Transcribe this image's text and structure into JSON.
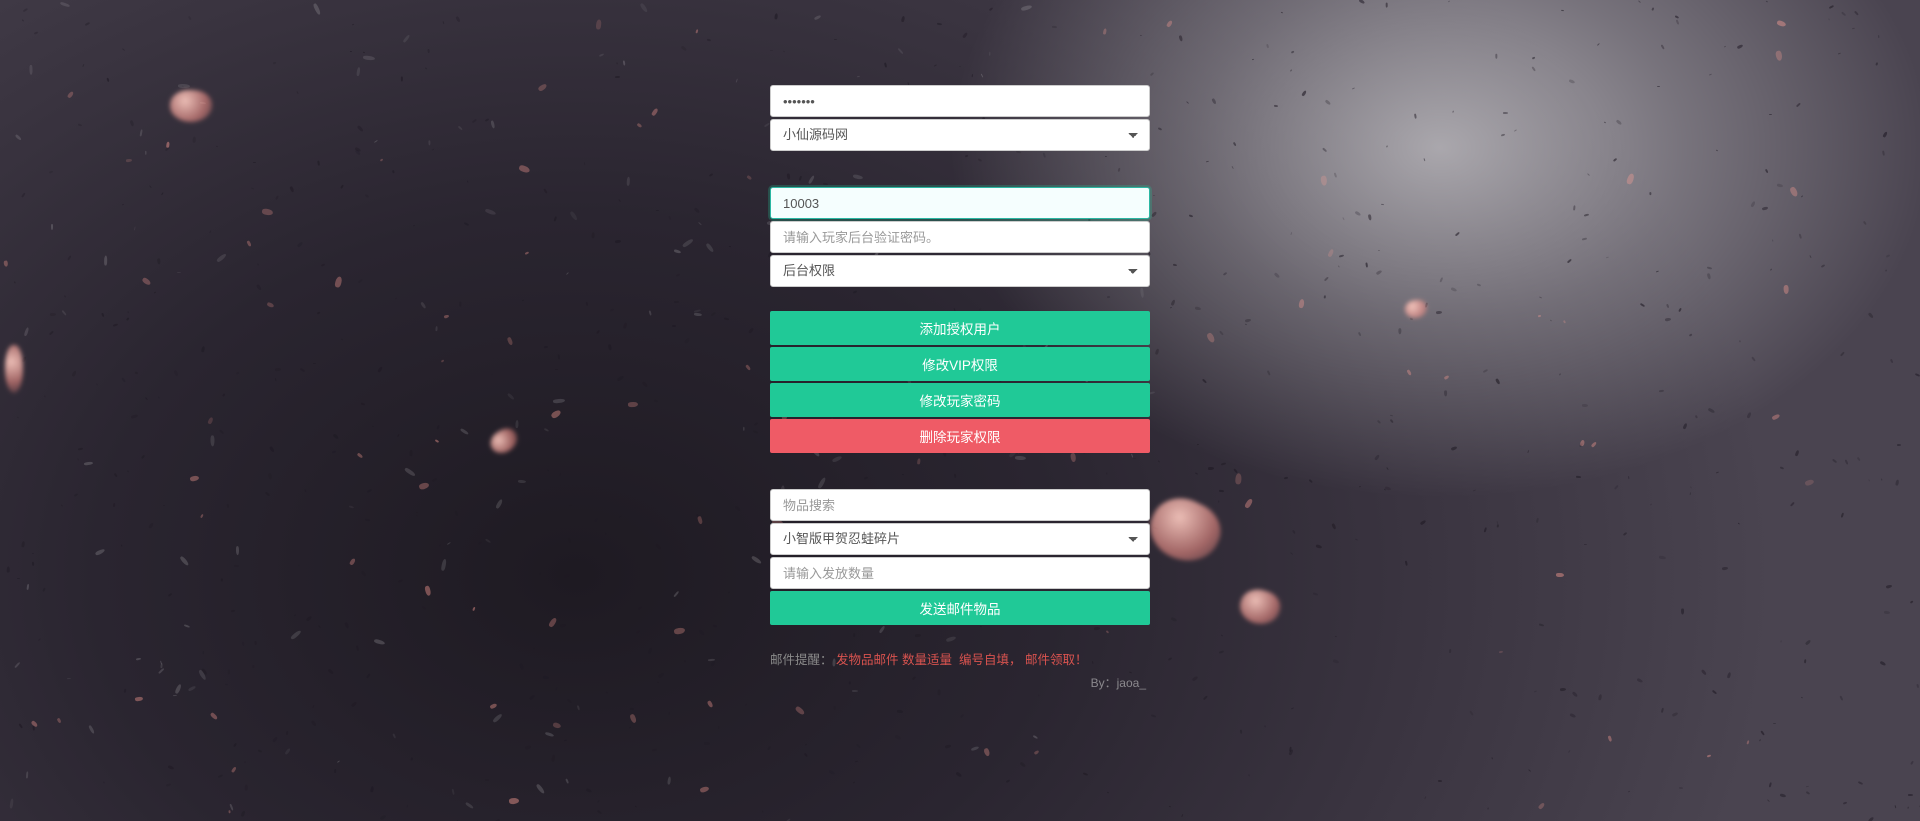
{
  "section1": {
    "password_value": "•••••••",
    "select_value": "小仙源码网"
  },
  "section2": {
    "player_id_value": "10003",
    "verify_pwd_placeholder": "请输入玩家后台验证密码。",
    "perm_select_value": "后台权限",
    "btn_add_user": "添加授权用户",
    "btn_mod_vip": "修改VIP权限",
    "btn_mod_pwd": "修改玩家密码",
    "btn_del_perm": "删除玩家权限"
  },
  "section3": {
    "search_placeholder": "物品搜索",
    "item_select_value": "小智版甲贺忍蛙碎片",
    "qty_placeholder": "请输入发放数量",
    "btn_send_mail": "发送邮件物品"
  },
  "footer": {
    "label": "邮件提醒：",
    "w1": "发物品邮件",
    "w2": "数量适量",
    "w3": "编号自填，",
    "w4": "邮件领取！",
    "credit": "By：jaoa_"
  }
}
